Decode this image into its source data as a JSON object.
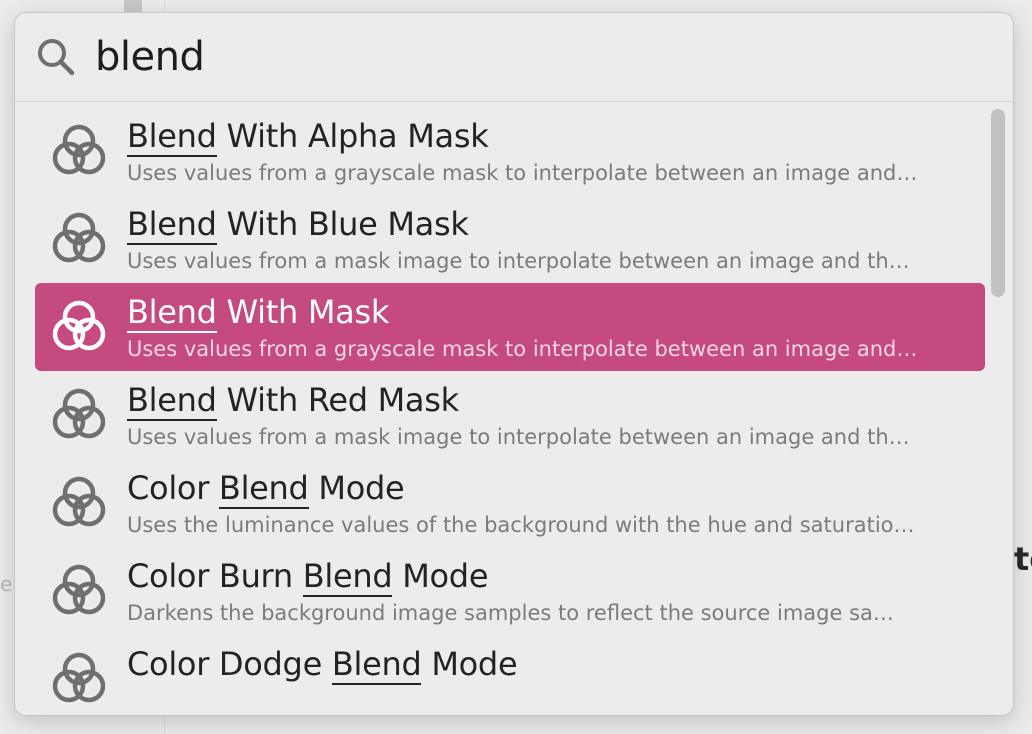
{
  "search": {
    "query": "blend"
  },
  "results": [
    {
      "match": "Blend",
      "pre": "",
      "post": " With Alpha Mask",
      "desc": "Uses values from a grayscale mask to interpolate between an image and…",
      "selected": false
    },
    {
      "match": "Blend",
      "pre": "",
      "post": " With Blue Mask",
      "desc": "Uses values from a mask image to interpolate between an image and th…",
      "selected": false
    },
    {
      "match": "Blend",
      "pre": "",
      "post": " With Mask",
      "desc": "Uses values from a grayscale mask to interpolate between an image and…",
      "selected": true
    },
    {
      "match": "Blend",
      "pre": "",
      "post": " With Red Mask",
      "desc": "Uses values from a mask image to interpolate between an image and th…",
      "selected": false
    },
    {
      "match": "Blend",
      "pre": "Color ",
      "post": " Mode",
      "desc": "Uses the luminance values of the background with the hue and saturatio…",
      "selected": false
    },
    {
      "match": "Blend",
      "pre": "Color Burn ",
      "post": " Mode",
      "desc": "Darkens the background image samples to reflect the source image sa…",
      "selected": false
    },
    {
      "match": "Blend",
      "pre": "Color Dodge ",
      "post": " Mode",
      "desc": "",
      "selected": false
    }
  ],
  "icons": {
    "result_icon": "three-circles-icon",
    "search_icon": "magnifier-icon"
  },
  "colors": {
    "selection": "#c44a80",
    "icon_gray": "#6f6f6f",
    "title": "#232323",
    "description": "#7b7b7b"
  },
  "background": {
    "left_fragment": "er",
    "right_fragment": "te"
  }
}
